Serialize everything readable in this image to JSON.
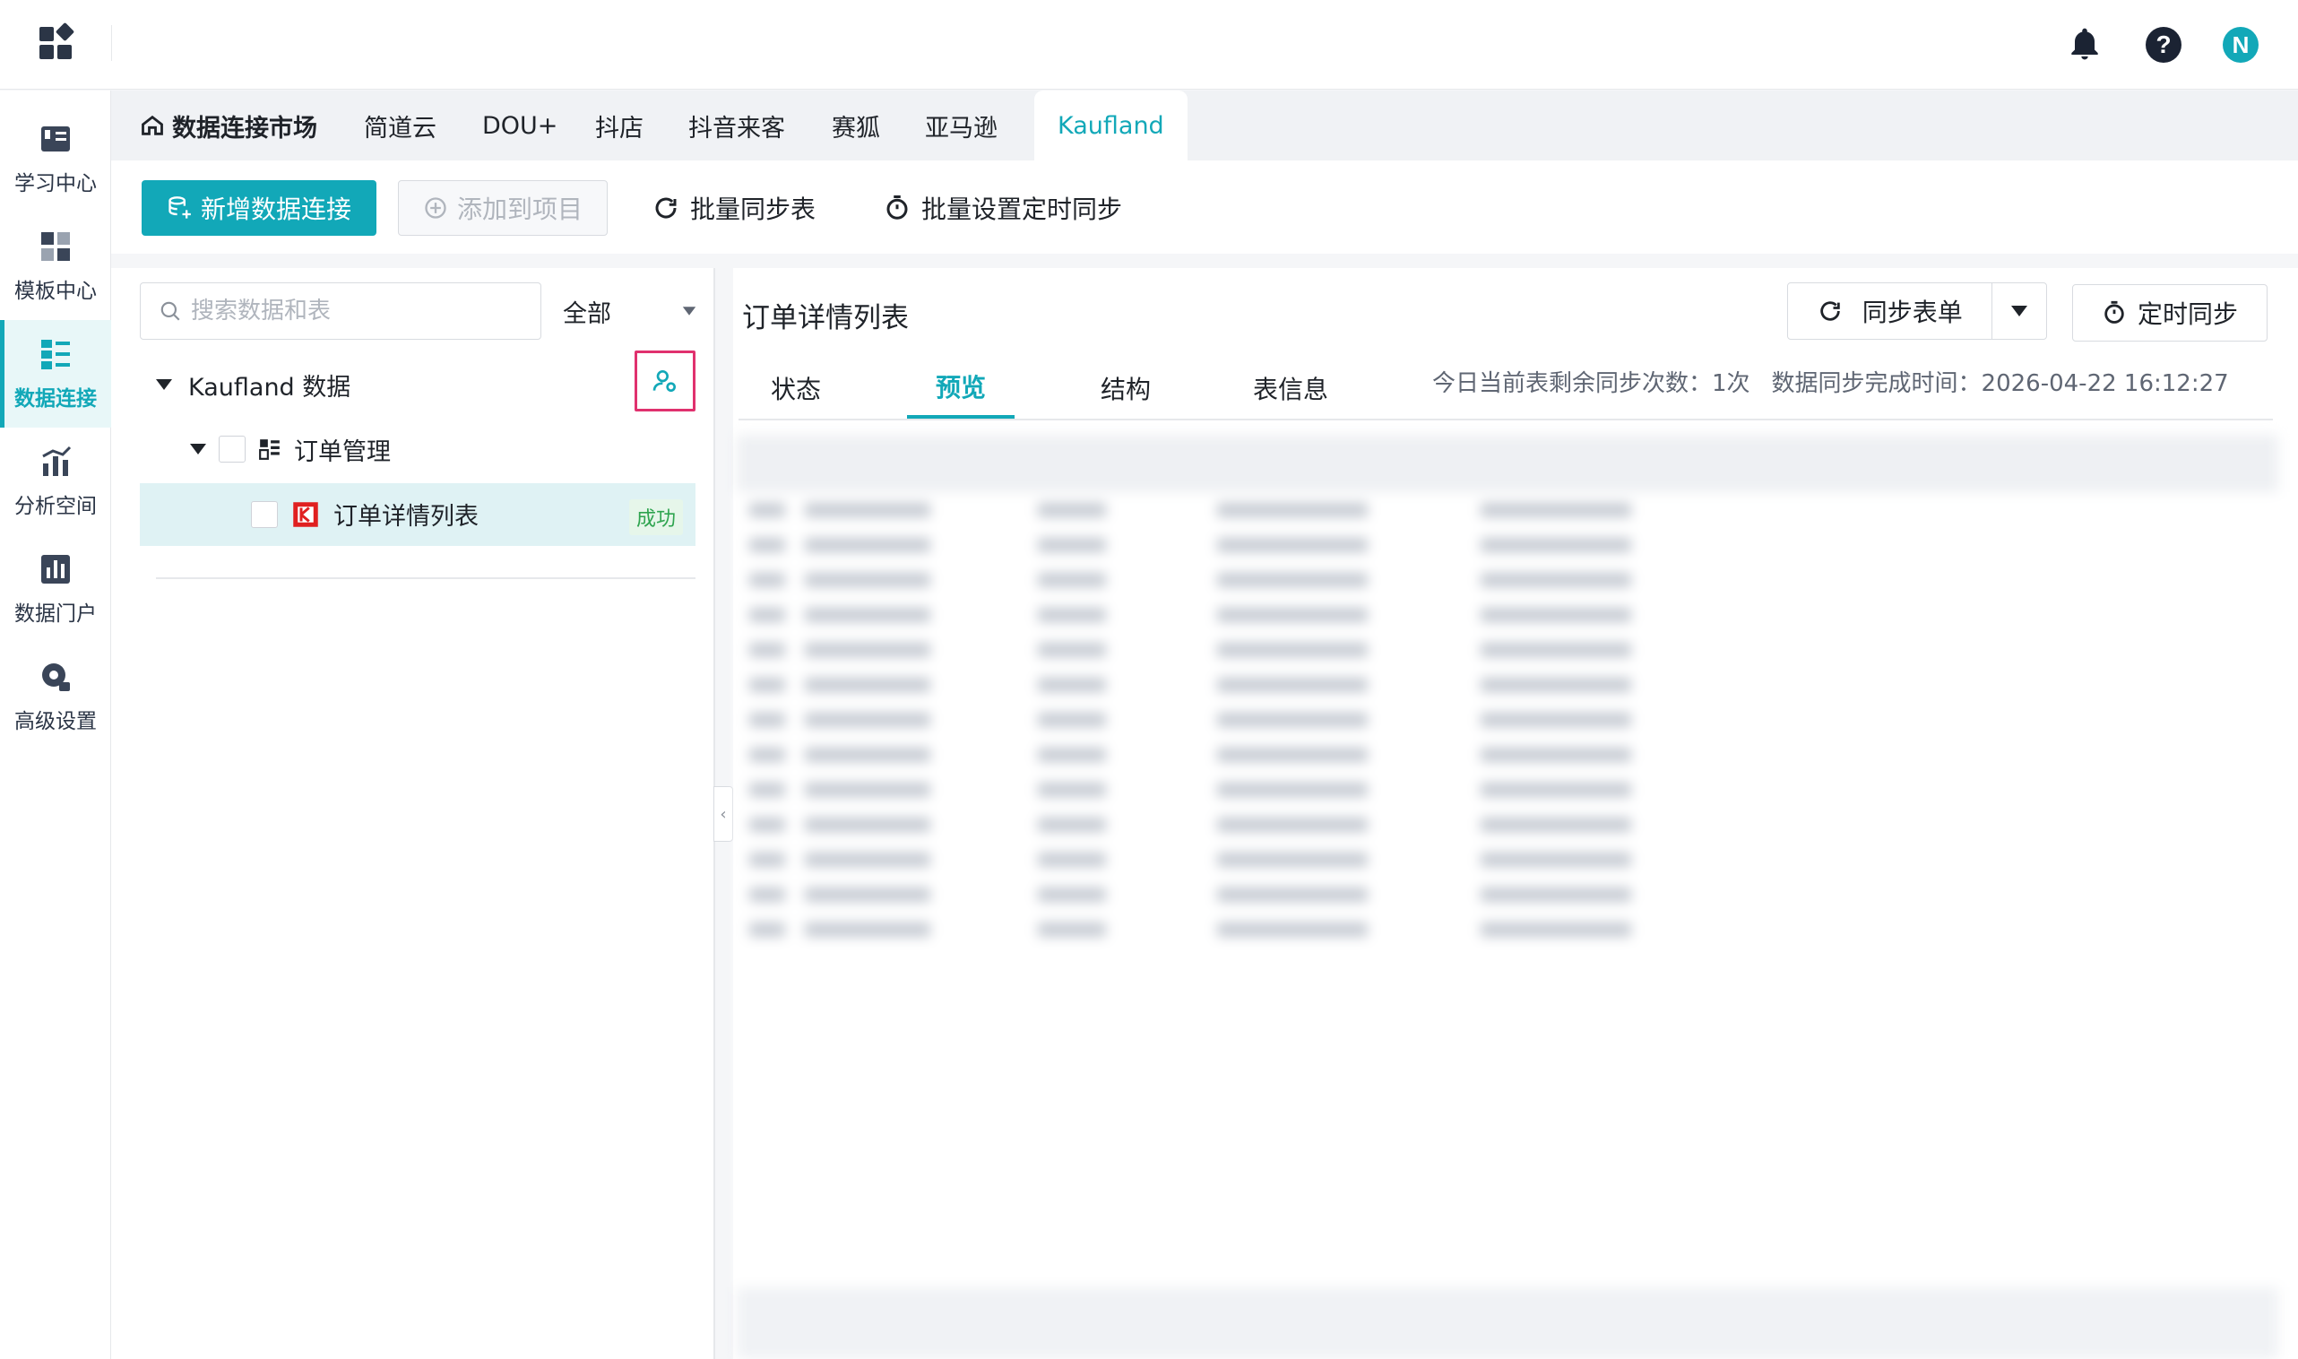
{
  "header": {
    "user_initial": "N"
  },
  "nav": [
    {
      "label": "学习中心",
      "icon": "learning-center-icon"
    },
    {
      "label": "模板中心",
      "icon": "template-center-icon"
    },
    {
      "label": "数据连接",
      "icon": "data-connection-icon",
      "active": true
    },
    {
      "label": "分析空间",
      "icon": "analysis-space-icon"
    },
    {
      "label": "数据门户",
      "icon": "data-portal-icon"
    },
    {
      "label": "高级设置",
      "icon": "advanced-settings-icon"
    }
  ],
  "tabs": {
    "home": "数据连接市场",
    "items": [
      "简道云",
      "DOU+",
      "抖店",
      "抖音来客",
      "赛狐",
      "亚马逊"
    ],
    "active": "Kaufland"
  },
  "toolbar": {
    "new_connection": "新增数据连接",
    "add_to_project": "添加到项目",
    "batch_sync": "批量同步表",
    "batch_schedule": "批量设置定时同步"
  },
  "left": {
    "search_placeholder": "搜索数据和表",
    "filter": "全部",
    "tree": {
      "root": "Kaufland 数据",
      "group": "订单管理",
      "table": "订单详情列表",
      "status": "成功"
    }
  },
  "right": {
    "title": "订单详情列表",
    "sync_button": "同步表单",
    "schedule_button": "定时同步",
    "tabs": [
      "状态",
      "预览",
      "结构",
      "表信息"
    ],
    "active_tab": "预览",
    "remaining": "今日当前表剩余同步次数：1次",
    "finished": "数据同步完成时间：2026-04-22 16:12:27"
  },
  "colors": {
    "accent": "#12a8b8",
    "highlight": "#e0316e",
    "success": "#2ea44f"
  }
}
